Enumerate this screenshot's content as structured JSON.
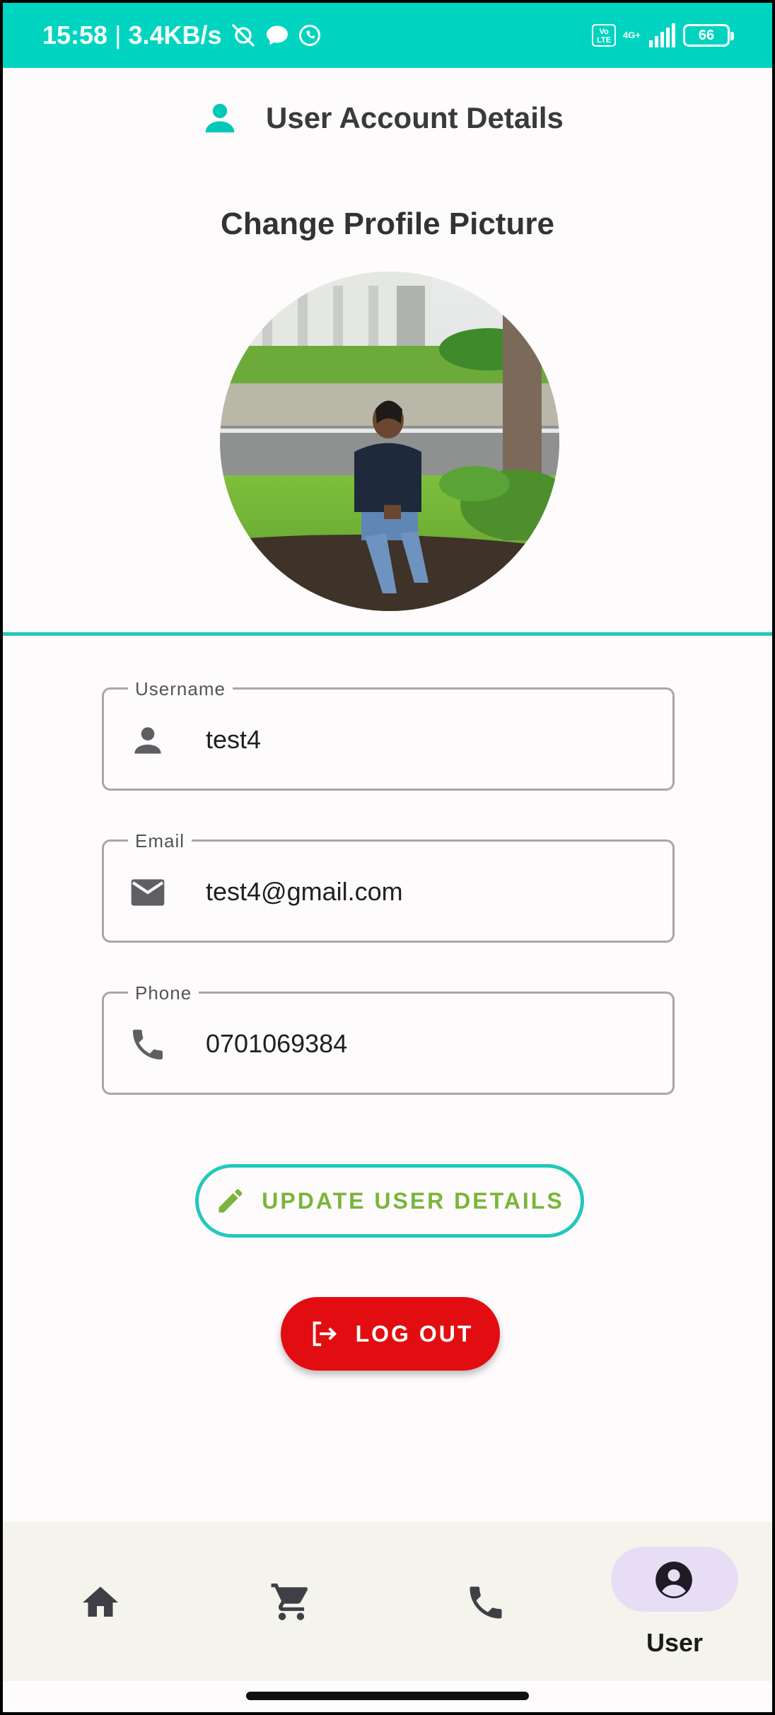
{
  "status_bar": {
    "time": "15:58",
    "speed": "3.4KB/s",
    "volte": "Vo LTE",
    "network": "4G+",
    "battery": "66"
  },
  "header": {
    "title": "User Account Details",
    "icon": "person-icon"
  },
  "profile": {
    "section_title": "Change Profile Picture"
  },
  "form": {
    "username": {
      "label": "Username",
      "value": "test4",
      "icon": "person-icon"
    },
    "email": {
      "label": "Email",
      "value": "test4@gmail.com",
      "icon": "mail-icon"
    },
    "phone": {
      "label": "Phone",
      "value": "0701069384",
      "icon": "phone-icon"
    }
  },
  "actions": {
    "update_label": "UPDATE USER DETAILS",
    "logout_label": "LOG OUT"
  },
  "bottom_nav": {
    "items": [
      {
        "icon": "home-icon"
      },
      {
        "icon": "cart-icon"
      },
      {
        "icon": "phone-icon"
      },
      {
        "icon": "account-circle-icon",
        "label": "User",
        "active": true
      }
    ]
  },
  "colors": {
    "accent": "#00d4c0",
    "update_text": "#7ab53a",
    "logout_bg": "#e20d10",
    "active_pill": "#e7def6"
  }
}
